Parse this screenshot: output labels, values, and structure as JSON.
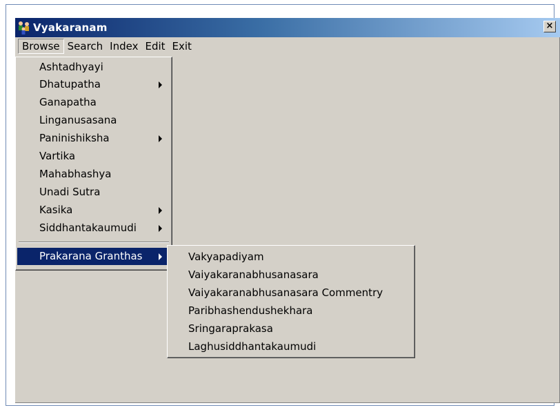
{
  "window": {
    "title": "Vyakaranam",
    "close_label": "×"
  },
  "menubar": {
    "items": [
      {
        "label": "Browse"
      },
      {
        "label": "Search"
      },
      {
        "label": "Index"
      },
      {
        "label": "Edit"
      },
      {
        "label": "Exit"
      }
    ]
  },
  "browse_menu": {
    "items": [
      {
        "label": "Ashtadhyayi",
        "has_submenu": false
      },
      {
        "label": "Dhatupatha",
        "has_submenu": true
      },
      {
        "label": "Ganapatha",
        "has_submenu": false
      },
      {
        "label": "Linganusasana",
        "has_submenu": false
      },
      {
        "label": "Paninishiksha",
        "has_submenu": true
      },
      {
        "label": "Vartika",
        "has_submenu": false
      },
      {
        "label": "Mahabhashya",
        "has_submenu": false
      },
      {
        "label": "Unadi Sutra",
        "has_submenu": false
      },
      {
        "label": "Kasika",
        "has_submenu": true
      },
      {
        "label": "Siddhantakaumudi",
        "has_submenu": true
      }
    ],
    "highlighted_item": {
      "label": "Prakarana Granthas",
      "has_submenu": true
    }
  },
  "prakarana_submenu": {
    "items": [
      {
        "label": "Vakyapadiyam"
      },
      {
        "label": "Vaiyakaranabhusanasara"
      },
      {
        "label": "Vaiyakaranabhusanasara Commentry"
      },
      {
        "label": "Paribhashendushekhara"
      },
      {
        "label": "Sringaraprakasa"
      },
      {
        "label": "Laghusiddhantakaumudi"
      }
    ]
  },
  "colors": {
    "titlebar_start": "#0a246a",
    "titlebar_end": "#a6caf0",
    "face": "#d4d0c8",
    "highlight": "#0a246a"
  }
}
